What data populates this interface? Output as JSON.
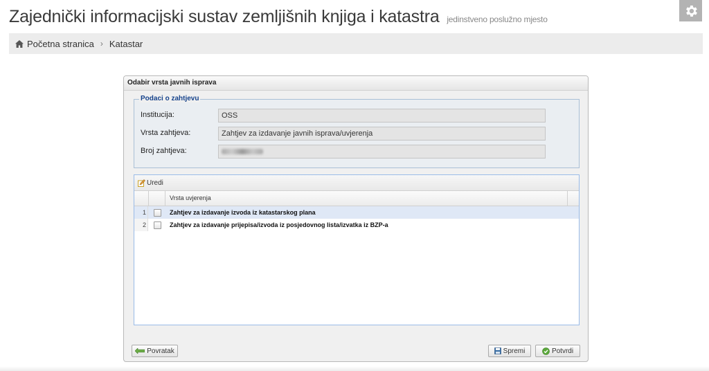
{
  "header": {
    "title": "Zajednički informacijski sustav zemljišnih knjiga i katastra",
    "subtitle": "jedinstveno poslužno mjesto"
  },
  "breadcrumb": {
    "items": [
      "Početna stranica",
      "Katastar"
    ]
  },
  "panel": {
    "title": "Odabir vrsta javnih isprava",
    "fieldset": {
      "legend": "Podaci o zahtjevu",
      "fields": [
        {
          "label": "Institucija:",
          "value": "OSS"
        },
        {
          "label": "Vrsta zahtjeva:",
          "value": "Zahtjev za izdavanje javnih isprava/uvjerenja"
        },
        {
          "label": "Broj zahtjeva:",
          "value": ""
        }
      ]
    },
    "grid": {
      "toolbar_edit": "Uredi",
      "column": "Vrsta uvjerenja",
      "rows": [
        {
          "num": "1",
          "text": "Zahtjev za izdavanje izvoda iz katastarskog plana"
        },
        {
          "num": "2",
          "text": "Zahtjev za izdavanje prijepisa/izvoda iz posjedovnog lista/izvatka iz BZP-a"
        }
      ]
    },
    "buttons": {
      "back": "Povratak",
      "save": "Spremi",
      "confirm": "Potvrdi"
    }
  }
}
